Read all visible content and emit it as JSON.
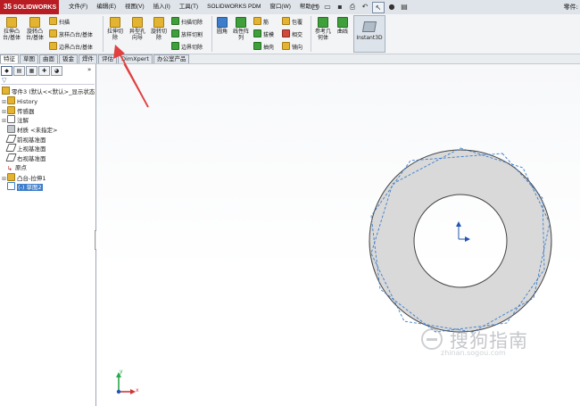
{
  "app": {
    "logo_text": "SOLIDWORKS",
    "window_title": "零件:"
  },
  "menu": {
    "items": [
      "文件(F)",
      "编辑(E)",
      "视图(V)",
      "插入(I)",
      "工具(T)",
      "SOLIDWORKS PDM",
      "窗口(W)",
      "帮助(H)"
    ]
  },
  "ribbon": {
    "extrude_boss": "拉伸凸台/基体",
    "revolve_boss": "旋转凸台/基体",
    "sweep": "扫描",
    "loft": "放样凸台/基体",
    "boundary_boss": "边界凸台/基体",
    "extrude_cut": "拉伸切除",
    "hole_wizard": "异型孔向导",
    "revolve_cut": "旋转切除",
    "swept_cut": "扫描切除",
    "lofted_cut": "放样切割",
    "boundary_cut": "边界切除",
    "fillet": "圆角",
    "linear_pattern": "线性阵列",
    "rib": "筋",
    "draft": "拔模",
    "shell": "抽壳",
    "wrap": "包覆",
    "intersect": "相交",
    "mirror": "镜向",
    "ref_geometry": "参考几何体",
    "curves": "曲线",
    "instant3d": "Instant3D"
  },
  "tabs": [
    "特征",
    "草图",
    "曲面",
    "钣金",
    "焊件",
    "评估",
    "DimXpert",
    "办公室产品"
  ],
  "feature_tree": {
    "root": "零件3 (默认<<默认>_显示状态",
    "items": [
      {
        "label": "History",
        "icon": "history-icon"
      },
      {
        "label": "传感器",
        "icon": "sensor-icon"
      },
      {
        "label": "注解",
        "icon": "annotation-icon"
      },
      {
        "label": "材质 <未指定>",
        "icon": "material-icon"
      },
      {
        "label": "前视基准面",
        "icon": "plane-icon"
      },
      {
        "label": "上视基准面",
        "icon": "plane-icon"
      },
      {
        "label": "右视基准面",
        "icon": "plane-icon"
      },
      {
        "label": "原点",
        "icon": "origin-icon"
      },
      {
        "label": "凸台-拉伸1",
        "icon": "extrude-icon"
      },
      {
        "label": "(-) 草图2",
        "icon": "sketch-icon"
      }
    ]
  },
  "viewport": {
    "axis_x": "x",
    "axis_y": "y"
  },
  "watermark": {
    "text": "搜狗指南",
    "sub": "zhinan.sogou.com"
  },
  "colors": {
    "accent": "#b81d24",
    "sketch": "#3d7dca",
    "arrow": "#e04040"
  }
}
